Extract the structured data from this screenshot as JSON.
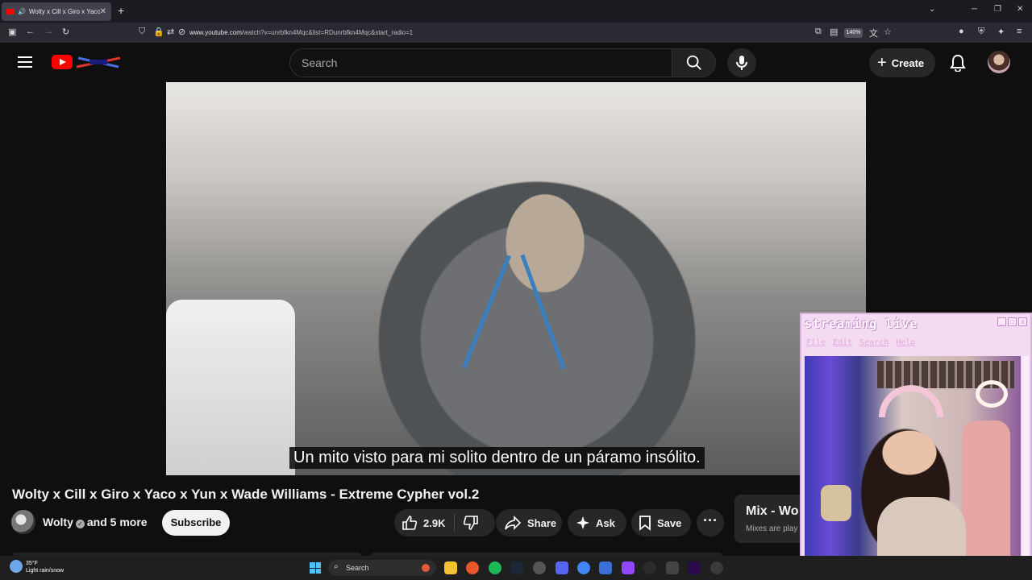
{
  "browser": {
    "tab_title": "Wolty x Cill x Giro x Yaco x",
    "new_tab": "+",
    "url_host": "www.youtube.com",
    "url_path": "/watch?v=unrbfkn4Mqc&list=RDunrbfkn4Mqc&start_radio=1",
    "zoom": "140%",
    "win_min": "─",
    "win_max": "❐",
    "win_close": "✕"
  },
  "youtube": {
    "search_placeholder": "Search",
    "create_label": "Create"
  },
  "video": {
    "subtitle": "Un mito visto para mi solito dentro de un páramo insólito.",
    "title": "Wolty x Cill x Giro x Yaco x Yun x Wade Williams - Extreme Cypher vol.2",
    "channel": "Wolty",
    "collaborators": "and 5 more",
    "subscribe_label": "Subscribe",
    "likes": "2.9K",
    "share_label": "Share",
    "ask_label": "Ask",
    "save_label": "Save",
    "more_label": "···"
  },
  "mix": {
    "title": "Mix - Wo",
    "subtitle": "Mixes are play"
  },
  "overlay": {
    "title": "streaming live",
    "menu": [
      "File",
      "Edit",
      "Search",
      "Help"
    ],
    "btn_min": "_",
    "btn_max": "□",
    "btn_close": "x"
  },
  "taskbar": {
    "temperature": "35°F",
    "weather": "Light rain/snow",
    "search_label": "Search"
  },
  "colors": {
    "yt_red": "#ff0000",
    "overlay_pink": "#f3dcf2",
    "accent_blue": "#4cc2ff"
  }
}
